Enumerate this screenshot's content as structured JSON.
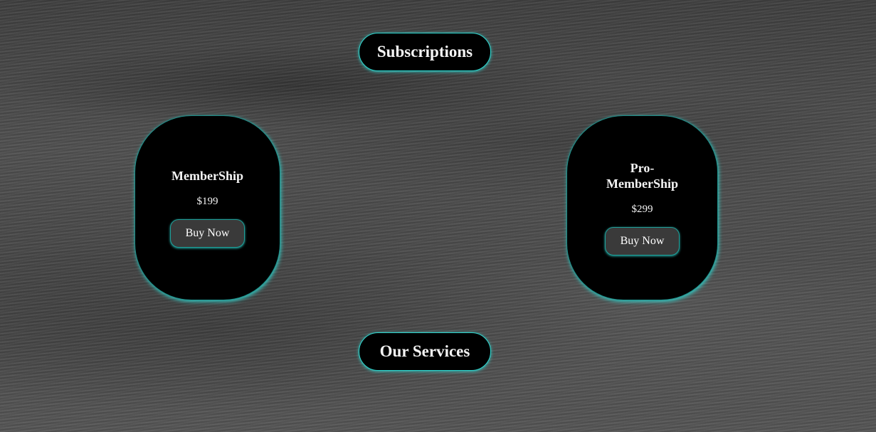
{
  "headings": {
    "subscriptions": "Subscriptions",
    "services": "Our Services"
  },
  "plans": [
    {
      "name": "MemberShip",
      "price": "$199",
      "button_label": "Buy Now"
    },
    {
      "name": "Pro-MemberShip",
      "price": "$299",
      "button_label": "Buy Now"
    }
  ],
  "colors": {
    "accent_glow": "#2fd6cf",
    "card_background": "#000000",
    "button_background": "#3a3a3a"
  }
}
